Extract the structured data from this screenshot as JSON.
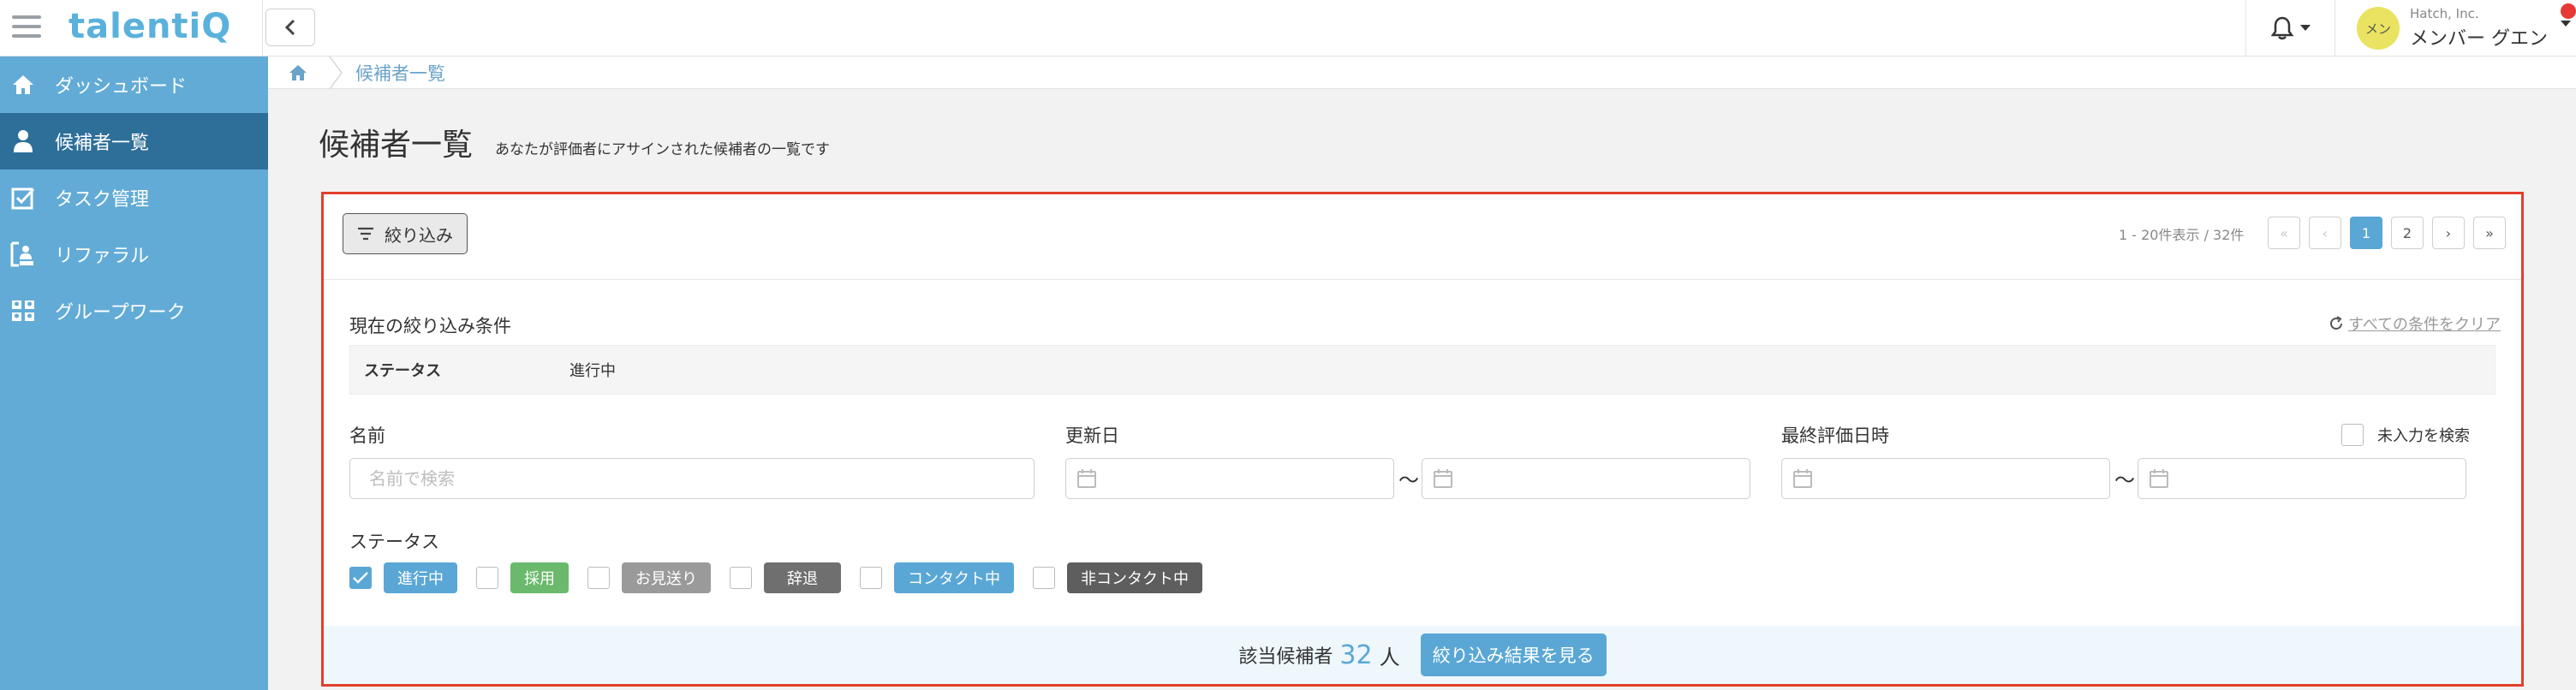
{
  "header": {
    "logo": "talentiQ",
    "company": "Hatch, Inc.",
    "user_name": "メンバー グエン",
    "avatar_text": "メン"
  },
  "sidebar": {
    "items": [
      {
        "label": "ダッシュボード",
        "icon": "home-icon",
        "active": false
      },
      {
        "label": "候補者一覧",
        "icon": "person-icon",
        "active": true
      },
      {
        "label": "タスク管理",
        "icon": "checkbox-icon",
        "active": false
      },
      {
        "label": "リファラル",
        "icon": "referral-icon",
        "active": false
      },
      {
        "label": "グループワーク",
        "icon": "group-icon",
        "active": false
      }
    ]
  },
  "breadcrumb": {
    "current": "候補者一覧"
  },
  "page": {
    "title": "候補者一覧",
    "description": "あなたが評価者にアサインされた候補者の一覧です"
  },
  "toolbar": {
    "filter_label": "絞り込み",
    "page_info": "1 - 20件表示 / 32件",
    "pages": [
      "1",
      "2"
    ],
    "current_page": "1"
  },
  "conditions": {
    "title": "現在の絞り込み条件",
    "clear_label": "すべての条件をクリア",
    "rows": [
      {
        "key": "ステータス",
        "value": "進行中"
      }
    ]
  },
  "form": {
    "name_label": "名前",
    "name_placeholder": "名前で検索",
    "updated_label": "更新日",
    "last_eval_label": "最終評価日時",
    "empty_search_label": "未入力を検索",
    "tilde": "〜",
    "status_label": "ステータス",
    "statuses": [
      {
        "label": "進行中",
        "color": "#5aa7d6",
        "checked": true
      },
      {
        "label": "採用",
        "color": "#6ab96c",
        "checked": false
      },
      {
        "label": "お見送り",
        "color": "#9a9a9a",
        "checked": false
      },
      {
        "label": "辞退",
        "color": "#6f6f6f",
        "checked": false
      },
      {
        "label": "コンタクト中",
        "color": "#5aa7d6",
        "checked": false
      },
      {
        "label": "非コンタクト中",
        "color": "#5e5e5e",
        "checked": false
      }
    ]
  },
  "result": {
    "label": "該当候補者",
    "count": "32",
    "unit": "人",
    "button_label": "絞り込み結果を見る"
  },
  "colors": {
    "sidebar": "#62abd6",
    "sidebar_active": "#2e6f9a",
    "accent": "#5aa7d6",
    "highlight_border": "#e23f2c",
    "notification": "#e53935"
  }
}
